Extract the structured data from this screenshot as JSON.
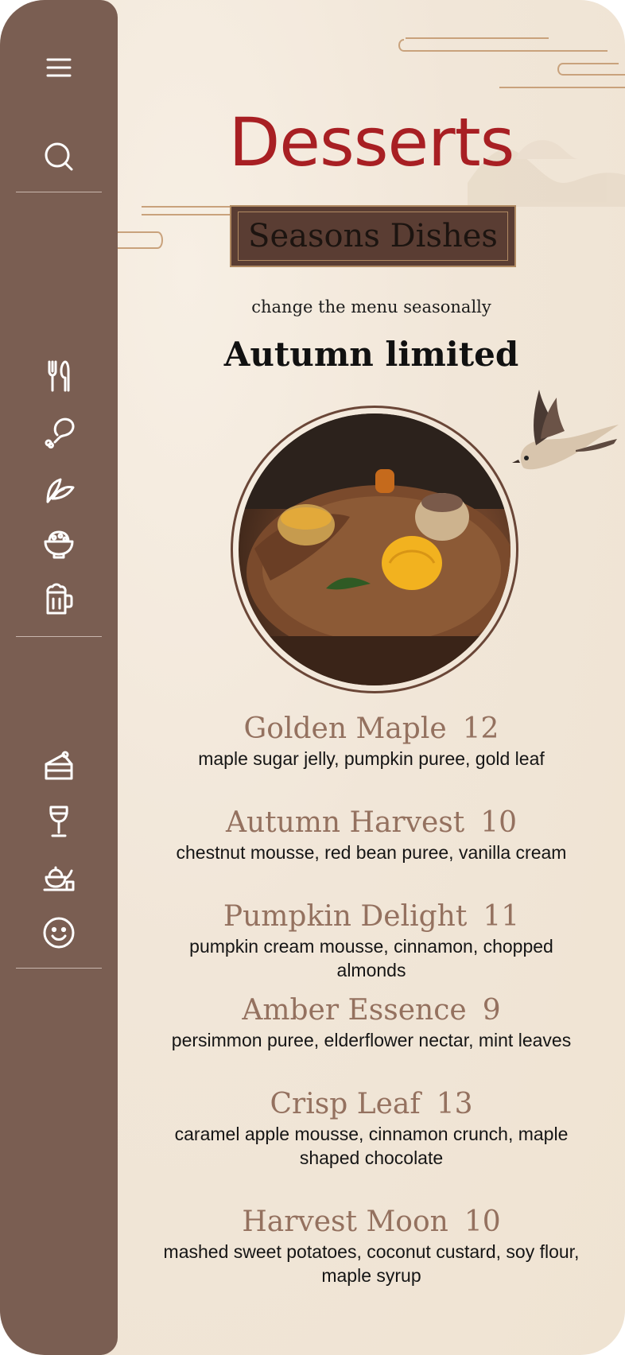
{
  "page": {
    "title": "Desserts",
    "banner": "Seasons Dishes",
    "subtitle": "change the menu seasonally",
    "season_heading": "Autumn limited"
  },
  "sidebar": {
    "top": [
      {
        "icon": "menu-icon"
      },
      {
        "icon": "search-icon"
      }
    ],
    "groups": [
      [
        {
          "icon": "utensils-icon"
        },
        {
          "icon": "drumstick-icon"
        },
        {
          "icon": "leaf-icon"
        },
        {
          "icon": "bowl-icon"
        },
        {
          "icon": "beer-mug-icon"
        }
      ],
      [
        {
          "icon": "cake-slice-icon"
        },
        {
          "icon": "wine-glass-icon"
        },
        {
          "icon": "teapot-icon"
        },
        {
          "icon": "smiley-icon"
        }
      ]
    ]
  },
  "menu": {
    "items": [
      {
        "name": "Golden Maple",
        "price": "12",
        "description": "maple sugar jelly, pumpkin puree, gold leaf"
      },
      {
        "name": "Autumn Harvest",
        "price": "10",
        "description": "chestnut mousse, red bean puree, vanilla cream"
      },
      {
        "name": "Pumpkin Delight",
        "price": "11",
        "description": "pumpkin cream mousse, cinnamon, chopped almonds"
      },
      {
        "name": "Amber Essence",
        "price": "9",
        "description": "persimmon puree, elderflower nectar, mint leaves"
      },
      {
        "name": "Crisp Leaf",
        "price": "13",
        "description": "caramel apple mousse, cinnamon crunch, maple shaped chocolate"
      },
      {
        "name": "Harvest Moon",
        "price": "10",
        "description": "mashed sweet potatoes, coconut custard, soy flour, maple syrup"
      }
    ]
  },
  "colors": {
    "sidebar": "#7a5e52",
    "title": "#a81f23",
    "item_name": "#94715f",
    "background": "#f1e6d8"
  }
}
